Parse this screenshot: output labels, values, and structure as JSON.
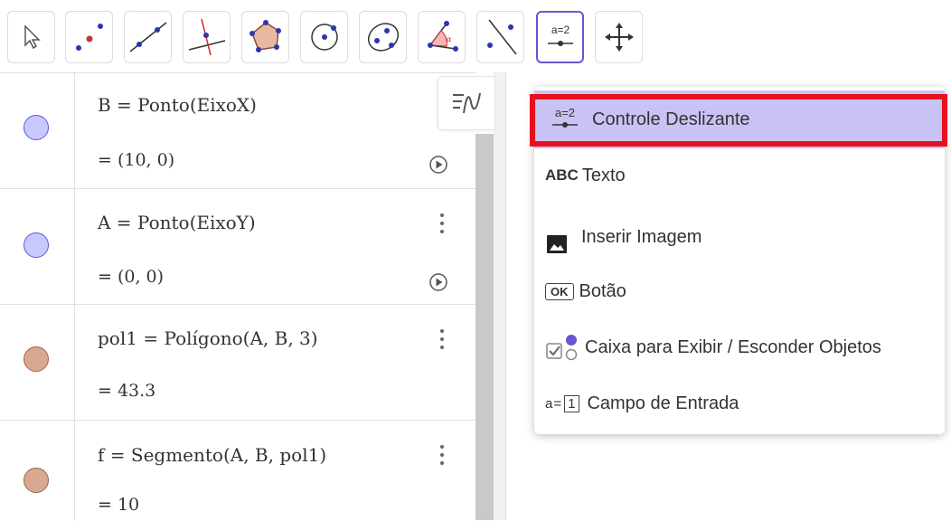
{
  "toolbar": {
    "tools": [
      {
        "name": "move-tool",
        "icon": "cursor-arrow-icon"
      },
      {
        "name": "point-tool",
        "icon": "point-icon"
      },
      {
        "name": "line-tool",
        "icon": "line-icon"
      },
      {
        "name": "perpendicular-line-tool",
        "icon": "perpendicular-icon"
      },
      {
        "name": "polygon-tool",
        "icon": "polygon-icon"
      },
      {
        "name": "circle-center-point-tool",
        "icon": "circle-icon"
      },
      {
        "name": "ellipse-tool",
        "icon": "ellipse-icon"
      },
      {
        "name": "angle-tool",
        "icon": "angle-icon"
      },
      {
        "name": "reflect-tool",
        "icon": "reflect-icon"
      },
      {
        "name": "slider-tool",
        "icon": "slider-icon",
        "label": "a=2",
        "active": true
      },
      {
        "name": "move-graphics-view-tool",
        "icon": "move-arrows-icon"
      }
    ]
  },
  "algebra": {
    "rows": [
      {
        "definition": "B = Ponto(EixoX)",
        "value": "= (10, 0)",
        "color": "#c8c8ff",
        "has_play": true
      },
      {
        "definition": "A = Ponto(EixoY)",
        "value": "= (0, 0)",
        "color": "#c8c8ff",
        "has_play": true
      },
      {
        "definition": "pol1 = Polígono(A, B, 3)",
        "value": "= 43.3",
        "color": "#d8a890",
        "has_play": false
      },
      {
        "definition": "f = Segmento(A, B, pol1)",
        "value": "= 10",
        "color": "#d8a890",
        "has_play": false
      }
    ]
  },
  "menu": {
    "items": [
      {
        "icon_text": "a=2",
        "label": "Controle Deslizante"
      },
      {
        "icon_text": "ABC",
        "label": "Texto"
      },
      {
        "icon_text": "",
        "label": "Inserir Imagem"
      },
      {
        "icon_text": "OK",
        "label": "Botão"
      },
      {
        "icon_text": "",
        "label": "Caixa para Exibir / Esconder Objetos"
      },
      {
        "icon_text": "a=1",
        "label": "Campo de Entrada"
      }
    ]
  },
  "colors": {
    "accent": "#6557d2",
    "highlight": "#c9c3f5",
    "annotation_red": "#e8101e"
  }
}
